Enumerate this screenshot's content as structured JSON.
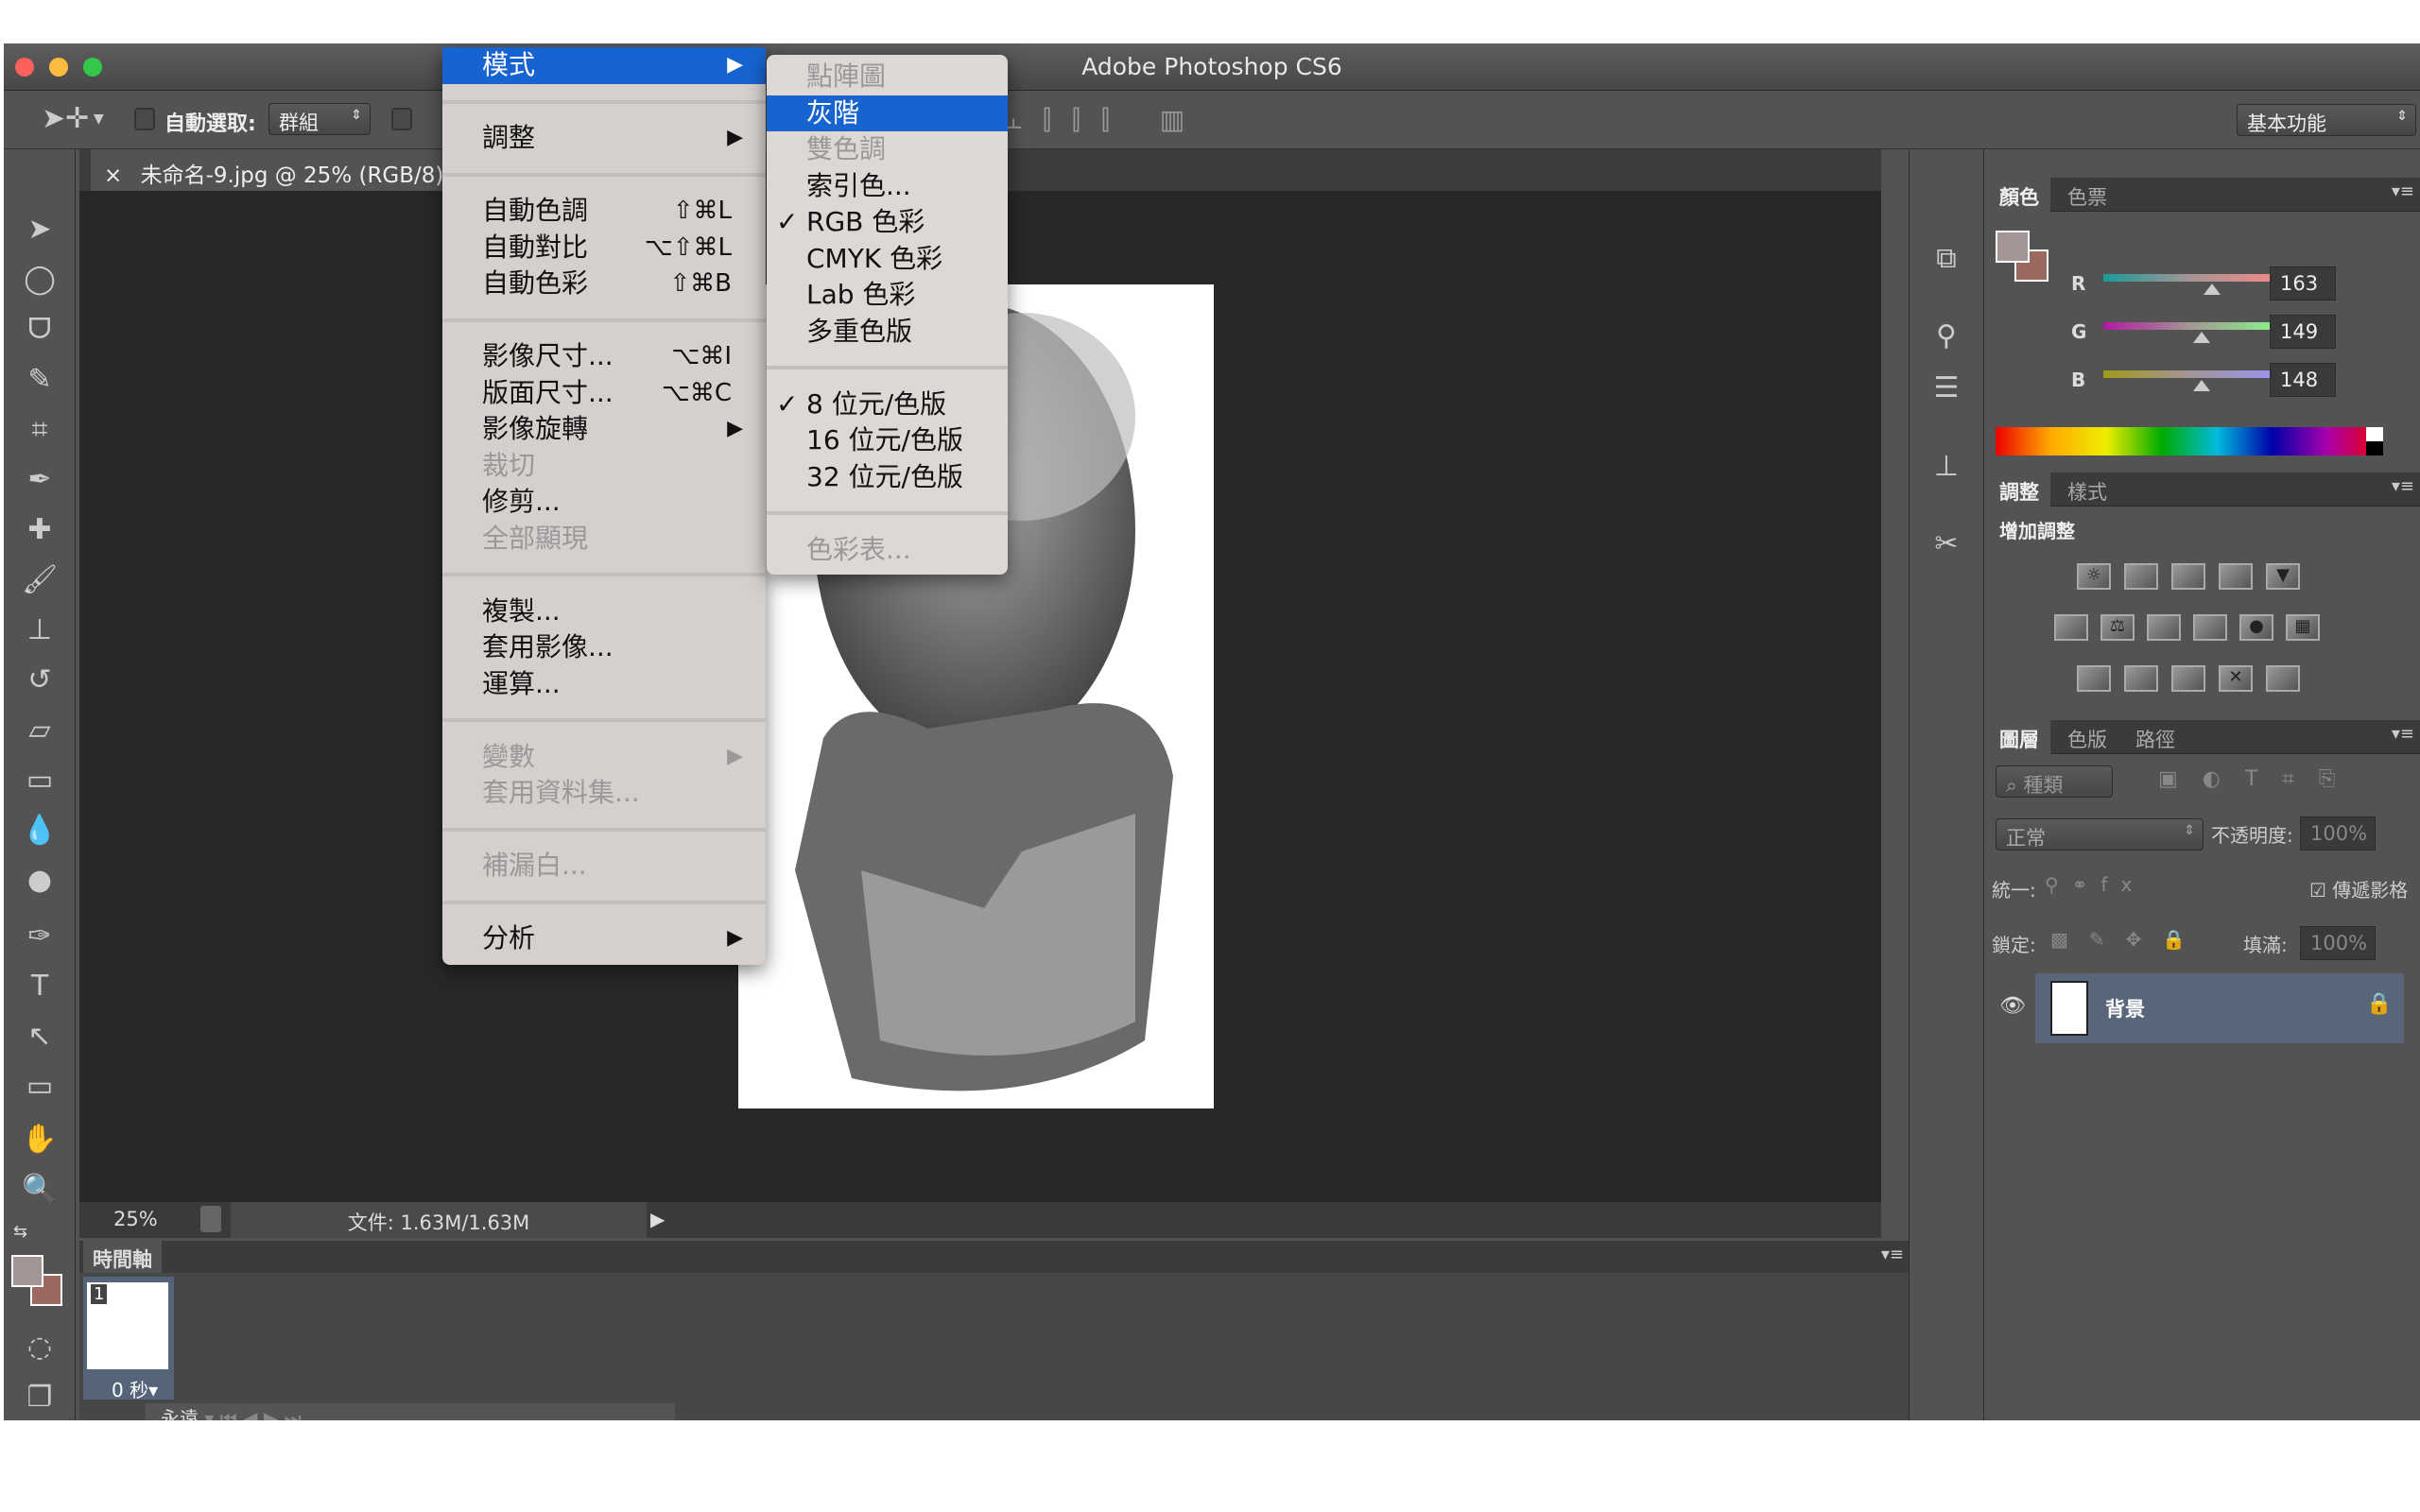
{
  "window": {
    "title": "Adobe Photoshop CS6"
  },
  "options": {
    "auto_select_label": "自動選取:",
    "auto_select_value": "群組",
    "workspace": "基本功能"
  },
  "document": {
    "tab_label": "未命名-9.jpg @ 25% (RGB/8)",
    "close": "×"
  },
  "status": {
    "zoom": "25%",
    "file_info": "文件: 1.63M/1.63M"
  },
  "timeline": {
    "tab": "時間軸",
    "frame_number": "1",
    "frame_delay": "0 秒",
    "loop": "永遠"
  },
  "menu": {
    "items": [
      {
        "label": "模式",
        "submenu": true,
        "highlighted": true
      },
      {
        "sep": true
      },
      {
        "label": "調整",
        "submenu": true
      },
      {
        "sep": true
      },
      {
        "label": "自動色調",
        "shortcut": "⇧⌘L"
      },
      {
        "label": "自動對比",
        "shortcut": "⌥⇧⌘L"
      },
      {
        "label": "自動色彩",
        "shortcut": "⇧⌘B"
      },
      {
        "sep": true
      },
      {
        "label": "影像尺寸...",
        "shortcut": "⌥⌘I"
      },
      {
        "label": "版面尺寸...",
        "shortcut": "⌥⌘C"
      },
      {
        "label": "影像旋轉",
        "submenu": true
      },
      {
        "label": "裁切",
        "disabled": true
      },
      {
        "label": "修剪..."
      },
      {
        "label": "全部顯現",
        "disabled": true
      },
      {
        "sep": true
      },
      {
        "label": "複製..."
      },
      {
        "label": "套用影像..."
      },
      {
        "label": "運算..."
      },
      {
        "sep": true
      },
      {
        "label": "變數",
        "disabled": true,
        "submenu": true
      },
      {
        "label": "套用資料集...",
        "disabled": true
      },
      {
        "sep": true
      },
      {
        "label": "補漏白...",
        "disabled": true
      },
      {
        "sep": true
      },
      {
        "label": "分析",
        "submenu": true
      }
    ]
  },
  "submenu": {
    "items": [
      {
        "label": "點陣圖",
        "disabled": true
      },
      {
        "label": "灰階",
        "highlighted": true
      },
      {
        "label": "雙色調",
        "disabled": true
      },
      {
        "label": "索引色..."
      },
      {
        "label": "RGB 色彩",
        "checked": true
      },
      {
        "label": "CMYK 色彩"
      },
      {
        "label": "Lab 色彩"
      },
      {
        "label": "多重色版"
      },
      {
        "sep": true
      },
      {
        "label": "8 位元/色版",
        "checked": true
      },
      {
        "label": "16 位元/色版"
      },
      {
        "label": "32 位元/色版"
      },
      {
        "sep": true
      },
      {
        "label": "色彩表...",
        "disabled": true
      }
    ]
  },
  "color_panel": {
    "tabs": [
      "顏色",
      "色票"
    ],
    "channels": [
      {
        "label": "R",
        "value": "163",
        "fraction": 0.64
      },
      {
        "label": "G",
        "value": "149",
        "fraction": 0.58
      },
      {
        "label": "B",
        "value": "148",
        "fraction": 0.58
      }
    ],
    "foreground": "#a39594",
    "background": "#9a6a60"
  },
  "adjust_panel": {
    "tabs": [
      "調整",
      "樣式"
    ],
    "heading": "增加調整"
  },
  "layers_panel": {
    "tabs": [
      "圖層",
      "色版",
      "路徑"
    ],
    "filter": "種類",
    "blend_mode": "正常",
    "opacity_label": "不透明度:",
    "opacity": "100%",
    "unify_label": "統一:",
    "propagate_label": "傳遞影格",
    "lock_label": "鎖定:",
    "fill_label": "填滿:",
    "fill": "100%",
    "layer_name": "背景"
  },
  "check": "✓"
}
